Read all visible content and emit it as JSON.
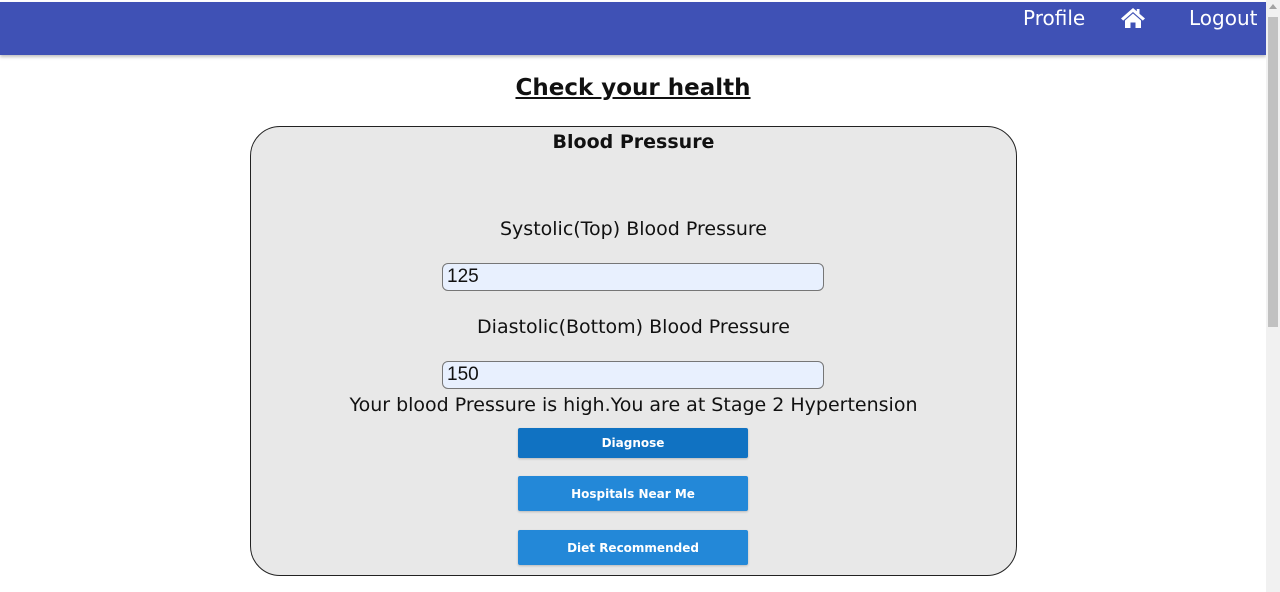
{
  "nav": {
    "profile_label": "Profile",
    "home_icon": "home-icon",
    "logout_label": "Logout",
    "bar_color": "#3f51b5"
  },
  "page": {
    "title": "Check your health"
  },
  "card": {
    "title": "Blood Pressure",
    "systolic_label": "Systolic(Top) Blood Pressure",
    "systolic_value": "125",
    "diastolic_label": "Diastolic(Bottom) Blood Pressure",
    "diastolic_value": "150",
    "result_text": "Your blood Pressure is high.You are at Stage 2 Hypertension"
  },
  "buttons": {
    "diagnose_label": "Diagnose",
    "hospitals_label": "Hospitals Near Me",
    "diet_label": "Diet Recommended"
  }
}
